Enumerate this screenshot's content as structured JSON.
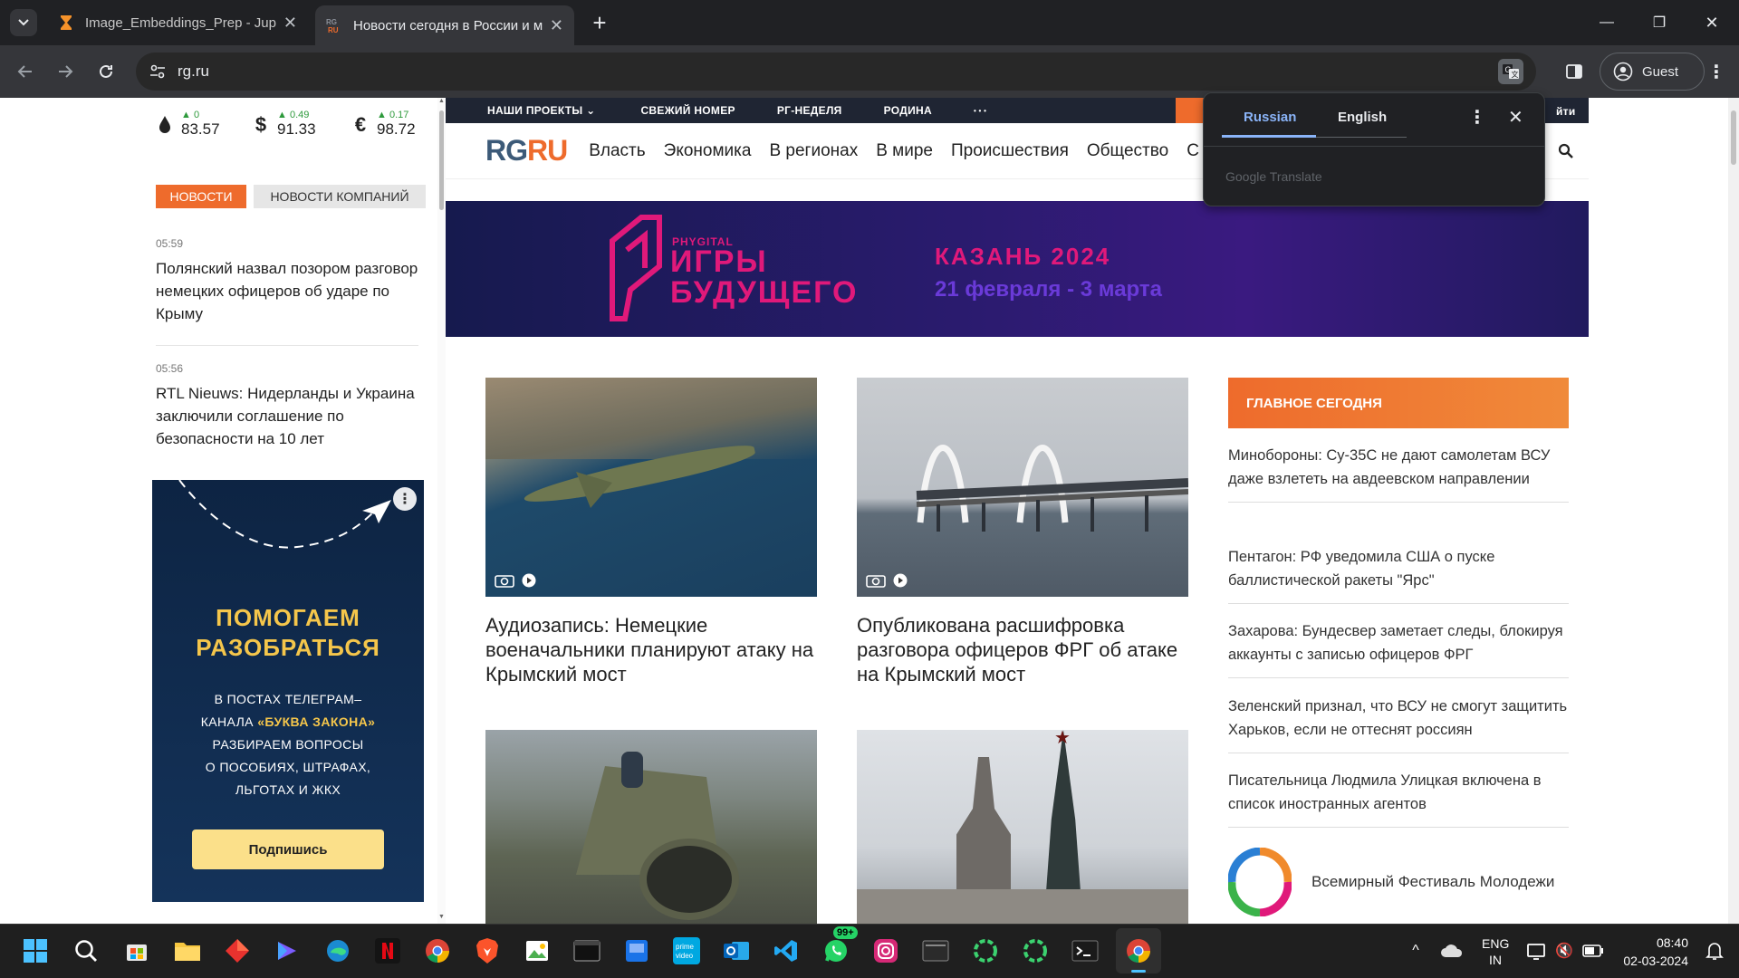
{
  "tabs": [
    {
      "title": "Image_Embeddings_Prep - Jupyter",
      "icon": "hourglass-icon"
    },
    {
      "title": "Новости сегодня в России и мире",
      "icon": "rgru-favicon",
      "active": true
    }
  ],
  "window_controls": {
    "minimize": "—",
    "restore": "❐",
    "close": "✕"
  },
  "address_bar": {
    "url": "rg.ru"
  },
  "profile": {
    "label": "Guest"
  },
  "currencies": [
    {
      "symbol": "💧",
      "change": "0",
      "value": "83.57"
    },
    {
      "symbol": "$",
      "change": "0.49",
      "value": "91.33"
    },
    {
      "symbol": "€",
      "change": "0.17",
      "value": "98.72"
    }
  ],
  "news_tabs": {
    "active": "НОВОСТИ",
    "inactive": "НОВОСТИ КОМПАНИЙ"
  },
  "left_news": [
    {
      "time": "05:59",
      "headline": "Полянский назвал позором разговор немецких офицеров об ударе по Крыму"
    },
    {
      "time": "05:56",
      "headline": "RTL Nieuws: Нидерланды и Украина заключили соглашение по безопасности на 10 лет"
    }
  ],
  "ad": {
    "title_line1": "ПОМОГАЕМ",
    "title_line2": "РАЗОБРАТЬСЯ",
    "body_lines": [
      "В ПОСТАХ ТЕЛЕГРАМ–",
      "КАНАЛА «БУКВА ЗАКОНА»",
      "РАЗБИРАЕМ ВОПРОСЫ",
      "О ПОСОБИЯХ, ШТРАФАХ,",
      "ЛЬГОТАХ И ЖКХ"
    ],
    "button": "Подпишись"
  },
  "top_nav": [
    "НАШИ ПРОЕКТЫ ⌄",
    "СВЕЖИЙ НОМЕР",
    "РГ-НЕДЕЛЯ",
    "РОДИНА",
    "• • •"
  ],
  "top_nav_right": "йти",
  "logo": {
    "part1": "RG",
    "part2": "RU"
  },
  "main_menu": [
    "Власть",
    "Экономика",
    "В регионах",
    "В мире",
    "Происшествия",
    "Общество",
    "С"
  ],
  "banner": {
    "small": "PHYGITAL",
    "line1": "ИГРЫ",
    "line2": "БУДУЩЕГО",
    "city": "КАЗАНЬ 2024",
    "dates": "21 февраля - 3 марта"
  },
  "cards": [
    {
      "headline": "Аудиозапись: Немецкие военачальники планируют атаку на Крымский мост"
    },
    {
      "headline": "Опубликована расшифровка разговора офицеров ФРГ об атаке на Крымский мост"
    },
    {
      "headline": ""
    },
    {
      "headline": ""
    }
  ],
  "main_today": {
    "title": "ГЛАВНОЕ СЕГОДНЯ",
    "items": [
      "Минобороны: Су-35С не дают самолетам ВСУ даже взлететь на авдеевском направлении",
      "Пентагон: РФ уведомила США о пуске баллистической ракеты \"Ярс\"",
      "Захарова: Бундесвер заметает следы, блокируя аккаунты с записью офицеров ФРГ",
      "Зеленский признал, что ВСУ не смогут защитить Харьков, если не оттеснят россиян",
      "Писательница Людмила Улицкая включена в список иностранных агентов"
    ],
    "festival": "Всемирный Фестиваль Молодежи"
  },
  "translate_popup": {
    "lang_from": "Russian",
    "lang_to": "English",
    "footer": "Google Translate"
  },
  "taskbar": {
    "lang_line1": "ENG",
    "lang_line2": "IN",
    "time": "08:40",
    "date": "02-03-2024",
    "whatsapp_badge": "99+"
  },
  "colors": {
    "accent": "#ee6b2c",
    "rg_blue": "#1f3a5f",
    "translate_blue": "#8ab4f8"
  }
}
